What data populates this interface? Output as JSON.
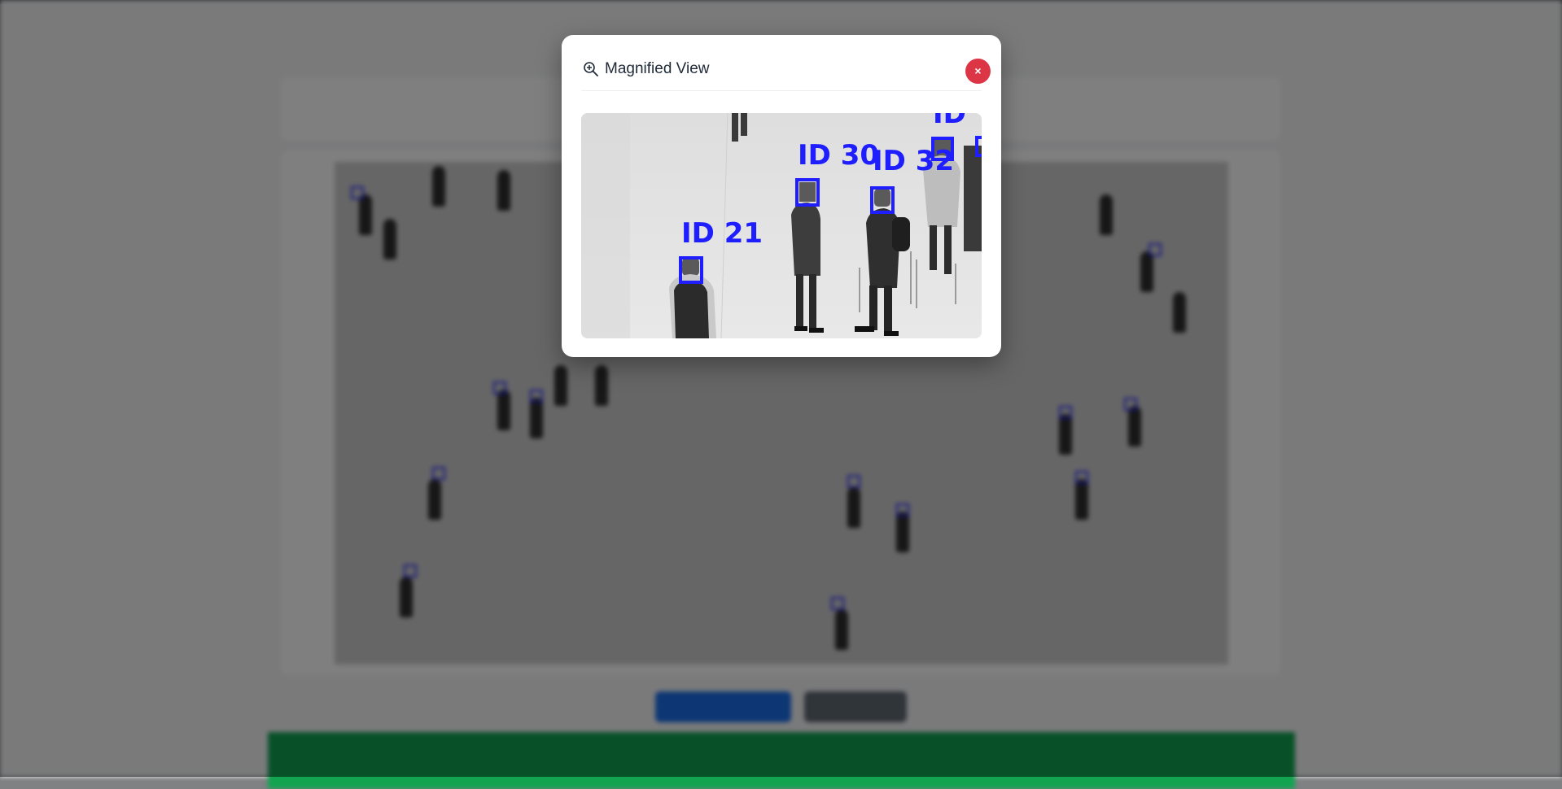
{
  "modal": {
    "title": "Magnified View",
    "close_label": "×",
    "icon": "zoom-in-icon"
  },
  "magnified": {
    "detections": [
      {
        "label": "ID 21"
      },
      {
        "label": "ID 30"
      },
      {
        "label": "ID 32"
      },
      {
        "label": "ID"
      }
    ]
  },
  "colors": {
    "close_button": "#dc3545",
    "detection_box": "#1e1eff",
    "overlay": "rgba(0,0,0,0.5)"
  }
}
